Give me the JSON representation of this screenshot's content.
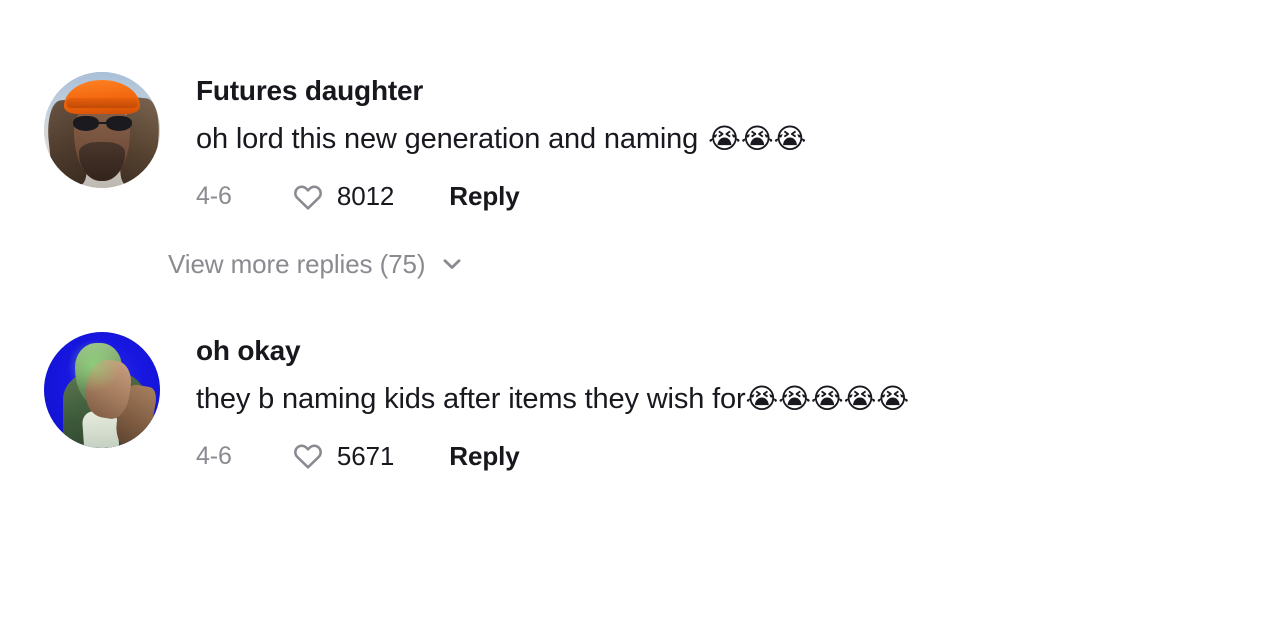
{
  "theme": {
    "background": "#ffffff",
    "text_primary": "#18181f",
    "text_secondary": "#8a8b91"
  },
  "comments": [
    {
      "username": "Futures daughter",
      "text": "oh lord this new generation and naming",
      "emojis": "😭😭😭",
      "emoji_spaced": true,
      "date": "4-6",
      "like_count": "8012",
      "reply_label": "Reply",
      "avatar_alt": "man wearing orange bandana and sunglasses with dreadlocks",
      "like_icon": "heart-icon"
    },
    {
      "username": "oh okay",
      "text": "they b naming kids after items they wish for",
      "emojis": "😭😭😭😭😭",
      "emoji_spaced": false,
      "date": "4-6",
      "like_count": "5671",
      "reply_label": "Reply",
      "avatar_alt": "person with hand covering face lit green on blue background",
      "like_icon": "heart-icon"
    }
  ],
  "view_more": {
    "label": "View more replies (75)",
    "count": "75",
    "icon": "chevron-down-icon"
  }
}
